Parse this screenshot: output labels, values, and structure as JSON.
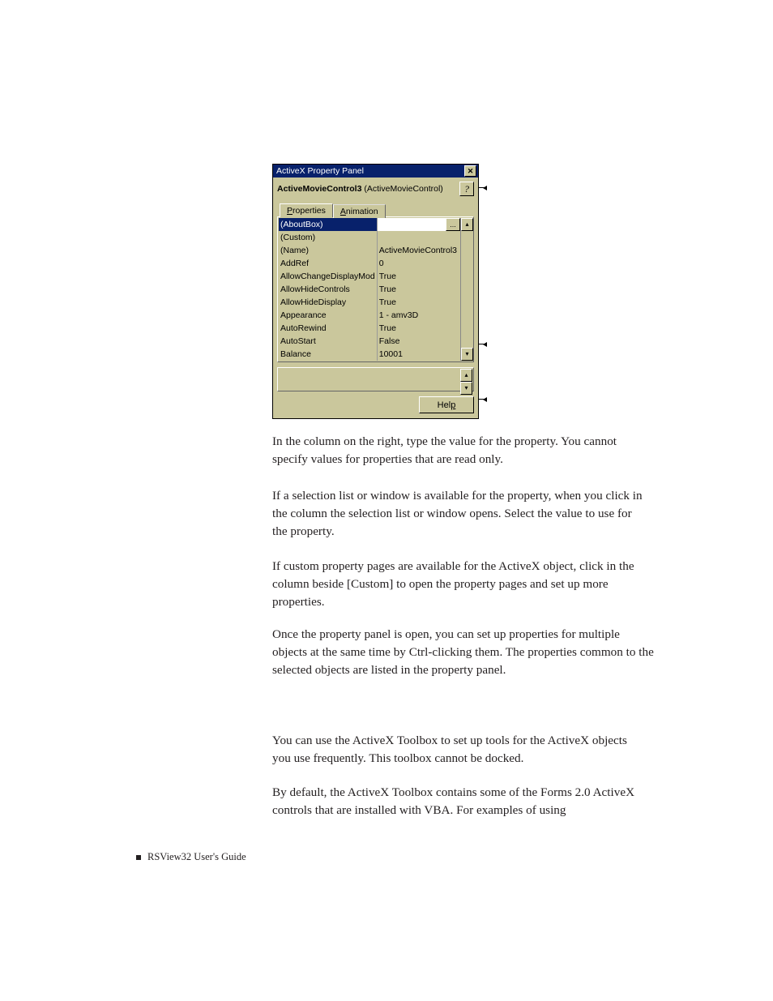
{
  "panel": {
    "title": "ActiveX Property Panel",
    "object_label_bold": "ActiveMovieControl3",
    "object_label_paren": "(ActiveMovieControl)",
    "help_q": "?",
    "tabs": {
      "properties": "Properties",
      "animation": "Animation"
    },
    "ellipsis": "...",
    "rows": [
      {
        "name": "(AboutBox)",
        "value": ""
      },
      {
        "name": "(Custom)",
        "value": ""
      },
      {
        "name": "(Name)",
        "value": "ActiveMovieControl3"
      },
      {
        "name": "AddRef",
        "value": "0"
      },
      {
        "name": "AllowChangeDisplayMod",
        "value": "True"
      },
      {
        "name": "AllowHideControls",
        "value": "True"
      },
      {
        "name": "AllowHideDisplay",
        "value": "True"
      },
      {
        "name": "Appearance",
        "value": "1 - amv3D"
      },
      {
        "name": "AutoRewind",
        "value": "True"
      },
      {
        "name": "AutoStart",
        "value": "False"
      },
      {
        "name": "Balance",
        "value": "10001"
      }
    ],
    "help_button": "Help",
    "arrows": {
      "up": "▴",
      "down": "▾"
    }
  },
  "paragraphs": {
    "p1": "In the column on the right, type the value for the property. You cannot specify values for properties that are read only.",
    "p2": "If a selection list or window is available for the property, when you click in the column the selection list or window opens. Select the value to use for the property.",
    "p3": "If custom property pages are available for the ActiveX object, click in the column beside [Custom] to open the property pages and set up more properties.",
    "p4": "Once the property panel is open, you can set up properties for multiple objects at the same time by Ctrl-clicking them. The properties common to the selected objects are listed in the property panel.",
    "p5": "You can use the ActiveX Toolbox to set up tools for the ActiveX objects you use frequently. This toolbox cannot be docked.",
    "p6": "By default, the ActiveX Toolbox contains some of the Forms 2.0 ActiveX controls that are installed with VBA. For examples of using"
  },
  "footer": "RSView32  User's Guide"
}
